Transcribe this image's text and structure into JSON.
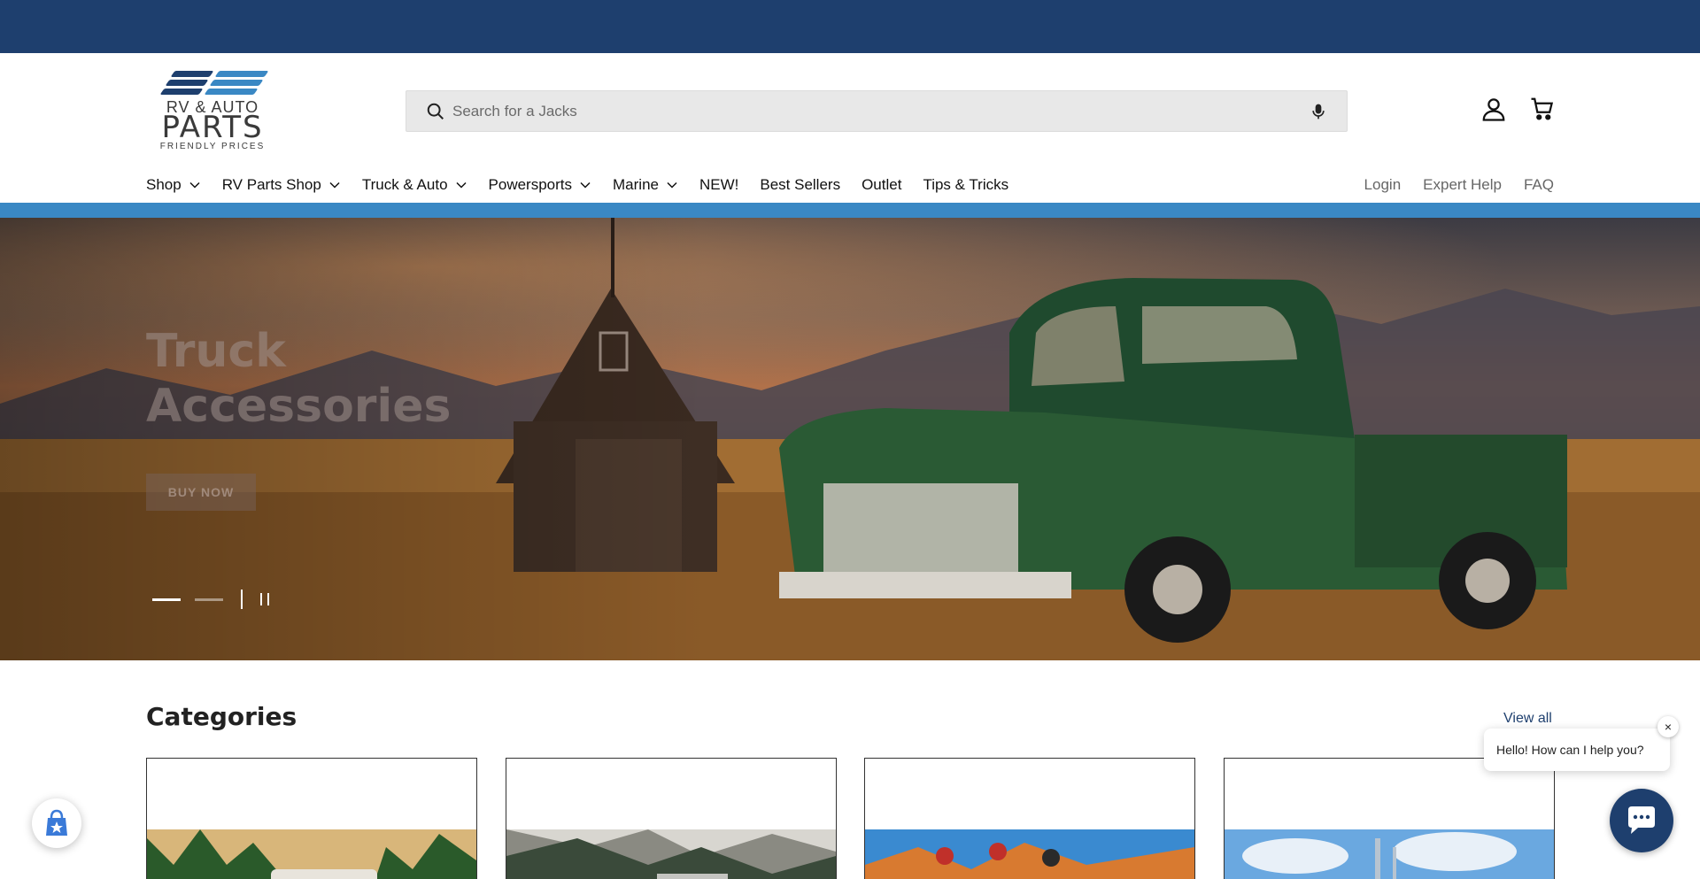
{
  "brand": {
    "logo_line1": "RV & AUTO",
    "logo_line2": "PARTS",
    "logo_line3": "FRIENDLY PRICES",
    "colors": {
      "primary": "#1e3f6e",
      "accent": "#3a88c4"
    }
  },
  "search": {
    "placeholder": "Search for a Jacks",
    "icon": "search-icon",
    "voice_icon": "microphone-icon"
  },
  "header_icons": [
    "account-icon",
    "cart-icon"
  ],
  "nav": {
    "items": [
      {
        "label": "Shop",
        "dropdown": true
      },
      {
        "label": "RV Parts Shop",
        "dropdown": true
      },
      {
        "label": "Truck & Auto",
        "dropdown": true
      },
      {
        "label": "Powersports",
        "dropdown": true
      },
      {
        "label": "Marine",
        "dropdown": true
      },
      {
        "label": "NEW!",
        "dropdown": false
      },
      {
        "label": "Best Sellers",
        "dropdown": false
      },
      {
        "label": "Outlet",
        "dropdown": false
      },
      {
        "label": "Tips & Tricks",
        "dropdown": false
      }
    ],
    "right": [
      {
        "label": "Login"
      },
      {
        "label": "Expert Help"
      },
      {
        "label": "FAQ"
      }
    ]
  },
  "hero": {
    "title_line1": "Truck",
    "title_line2": "Accessories",
    "button": "BUY NOW",
    "slides": 2,
    "active_slide": 1
  },
  "categories": {
    "title": "Categories",
    "view_all": "View all"
  },
  "chat": {
    "greeting": " Hello! How can I help you?",
    "close": "×"
  }
}
